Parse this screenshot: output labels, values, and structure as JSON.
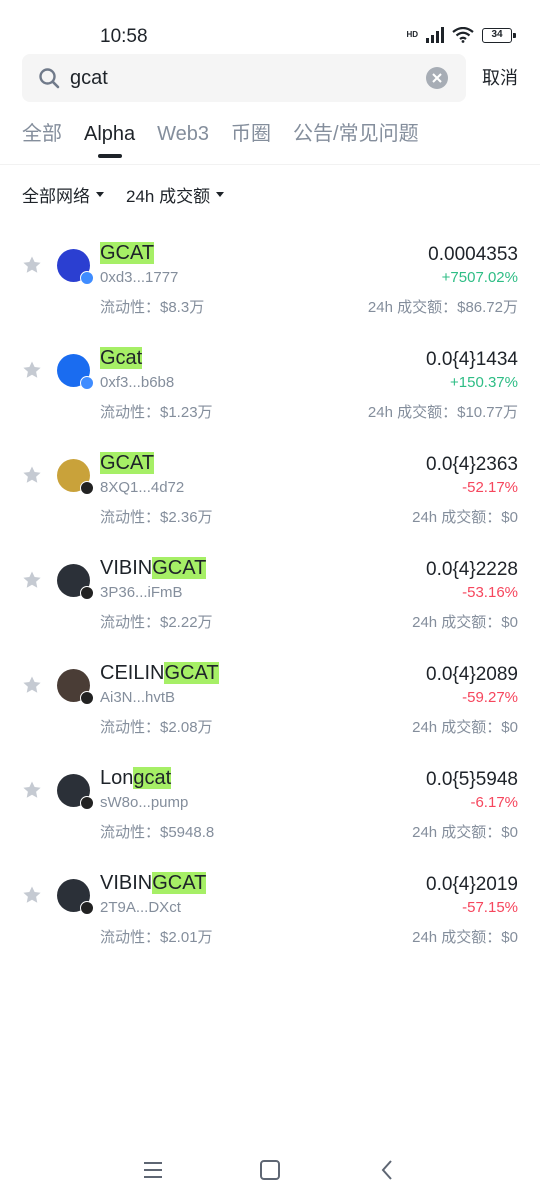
{
  "status_bar": {
    "time": "10:58",
    "network": "HD",
    "battery": "34"
  },
  "search": {
    "query": "gcat",
    "placeholder": "",
    "cancel_label": "取消"
  },
  "tabs": [
    {
      "label": "全部",
      "active": false
    },
    {
      "label": "Alpha",
      "active": true
    },
    {
      "label": "Web3",
      "active": false
    },
    {
      "label": "币圈",
      "active": false
    },
    {
      "label": "公告/常见问题",
      "active": false
    }
  ],
  "filters": {
    "network": "全部网络",
    "sort": "24h 成交额"
  },
  "colors": {
    "highlight": "#a6ef66",
    "up": "#2ebd85",
    "down": "#f6465d",
    "muted": "#848e9c"
  },
  "tokens": [
    {
      "prefix": "",
      "match": "GCAT",
      "address": "0xd3...1777",
      "liquidity": "流动性：$8.3万",
      "price": "0.0004353",
      "change": "+7507.02%",
      "direction": "up",
      "volume": "24h 成交额：$86.72万",
      "avatar_color": "#2b3fd1",
      "chain_color": "#3f8cff"
    },
    {
      "prefix": "",
      "match": "Gcat",
      "address": "0xf3...b6b8",
      "liquidity": "流动性：$1.23万",
      "price": "0.0{4}1434",
      "change": "+150.37%",
      "direction": "up",
      "volume": "24h 成交额：$10.77万",
      "avatar_color": "#1a6cf0",
      "chain_color": "#3f8cff"
    },
    {
      "prefix": "",
      "match": "GCAT",
      "address": "8XQ1...4d72",
      "liquidity": "流动性：$2.36万",
      "price": "0.0{4}2363",
      "change": "-52.17%",
      "direction": "down",
      "volume": "24h 成交额：$0",
      "avatar_color": "#c9a23a",
      "chain_color": "#222222"
    },
    {
      "prefix": "VIBIN",
      "match": "GCAT",
      "address": "3P36...iFmB",
      "liquidity": "流动性：$2.22万",
      "price": "0.0{4}2228",
      "change": "-53.16%",
      "direction": "down",
      "volume": "24h 成交额：$0",
      "avatar_color": "#2b3038",
      "chain_color": "#222222"
    },
    {
      "prefix": "CEILIN",
      "match": "GCAT",
      "address": "Ai3N...hvtB",
      "liquidity": "流动性：$2.08万",
      "price": "0.0{4}2089",
      "change": "-59.27%",
      "direction": "down",
      "volume": "24h 成交额：$0",
      "avatar_color": "#4a3d36",
      "chain_color": "#222222"
    },
    {
      "prefix": "Lon",
      "match": "gcat",
      "address": "sW8o...pump",
      "liquidity": "流动性：$5948.8",
      "price": "0.0{5}5948",
      "change": "-6.17%",
      "direction": "down",
      "volume": "24h 成交额：$0",
      "avatar_color": "#2b3038",
      "chain_color": "#222222"
    },
    {
      "prefix": "VIBIN",
      "match": "GCAT",
      "address": "2T9A...DXct",
      "liquidity": "流动性：$2.01万",
      "price": "0.0{4}2019",
      "change": "-57.15%",
      "direction": "down",
      "volume": "24h 成交额：$0",
      "avatar_color": "#2b3038",
      "chain_color": "#222222"
    }
  ],
  "nav": [
    "menu-icon",
    "home-icon",
    "back-icon"
  ]
}
